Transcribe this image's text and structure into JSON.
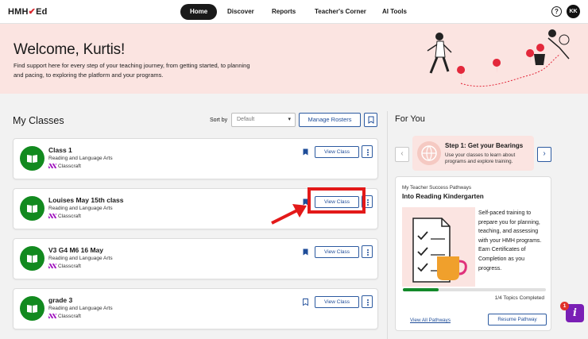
{
  "brand": {
    "name": "HMH",
    "suffix": "Ed"
  },
  "nav": {
    "items": [
      {
        "label": "Home",
        "active": true
      },
      {
        "label": "Discover",
        "active": false
      },
      {
        "label": "Reports",
        "active": false
      },
      {
        "label": "Teacher's Corner",
        "active": false
      },
      {
        "label": "AI Tools",
        "active": false
      }
    ],
    "help_label": "?",
    "avatar_initials": "KK"
  },
  "hero": {
    "title": "Welcome, Kurtis!",
    "subtitle": "Find support here for every step of your teaching journey, from getting started, to planning and pacing, to exploring the platform and your programs."
  },
  "classes": {
    "heading": "My Classes",
    "sort_label": "Sort by",
    "sort_value": "Default",
    "manage_label": "Manage Rosters",
    "items": [
      {
        "name": "Class 1",
        "subject": "Reading and Language Arts",
        "tag": "Classcraft",
        "bookmarked": true,
        "view_label": "View Class"
      },
      {
        "name": "Louises May 15th class",
        "subject": "Reading and Language Arts",
        "tag": "Classcraft",
        "bookmarked": true,
        "view_label": "View Class"
      },
      {
        "name": "V3 G4 M6 16 May",
        "subject": "Reading and Language Arts",
        "tag": "Classcraft",
        "bookmarked": true,
        "view_label": "View Class"
      },
      {
        "name": "grade 3",
        "subject": "Reading and Language Arts",
        "tag": "Classcraft",
        "bookmarked": false,
        "view_label": "View Class"
      }
    ]
  },
  "for_you": {
    "heading": "For You",
    "tip": {
      "title": "Step 1: Get your Bearings",
      "desc": "Use your classes to learn about programs and explore training."
    },
    "pathway": {
      "label": "My Teacher Success Pathways",
      "title": "Into Reading Kindergarten",
      "desc": "Self-paced training to prepare you for planning, teaching, and assessing with your HMH programs. Earn Certificates of Completion as you progress.",
      "progress_fraction": 0.25,
      "topics": "1/4 Topics Completed",
      "view_all": "View All Pathways",
      "resume": "Resume Pathway"
    }
  },
  "ai_tools": {
    "badge": "1",
    "glyph": "i"
  },
  "colors": {
    "accent": "#1f4d99",
    "class_icon": "#128a1f",
    "hero_bg": "#fbe4e1",
    "annotation": "#e31919"
  }
}
